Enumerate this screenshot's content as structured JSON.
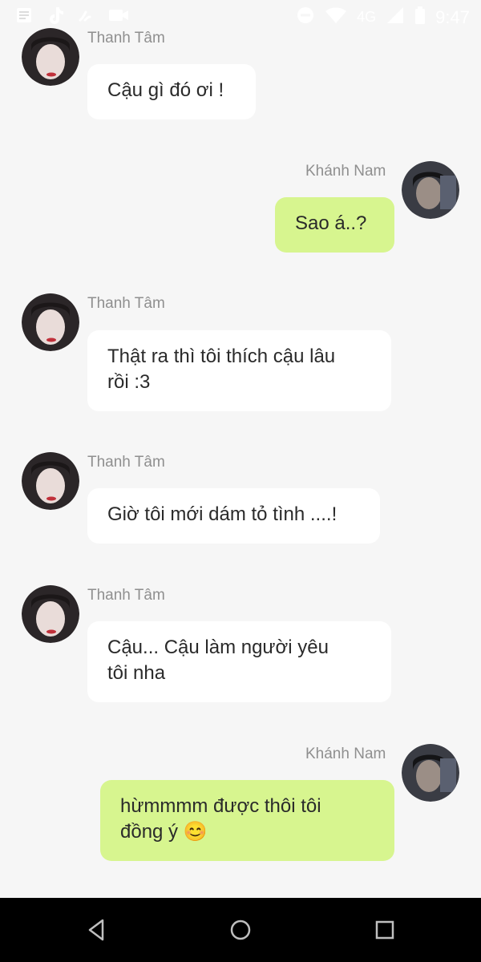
{
  "status_bar": {
    "network": "4G",
    "time": "9:47",
    "left_icons": [
      "news-icon",
      "tiktok-icon",
      "gesture-icon",
      "video-icon"
    ],
    "right_icons": [
      "do-not-disturb-icon",
      "wifi-icon",
      "signal-icon",
      "battery-icon"
    ]
  },
  "messages": [
    {
      "sender": "Thanh Tâm",
      "side": "incoming",
      "text": "Cậu gì đó ơi !"
    },
    {
      "sender": "Khánh Nam",
      "side": "outgoing",
      "text": "Sao á..?"
    },
    {
      "sender": "Thanh Tâm",
      "side": "incoming",
      "text_lines": [
        "Thật ra thì tôi thích cậu lâu",
        "rồi :3"
      ]
    },
    {
      "sender": "Thanh Tâm",
      "side": "incoming",
      "text": "Giờ tôi mới dám tỏ tình ....!"
    },
    {
      "sender": "Thanh Tâm",
      "side": "incoming",
      "text_lines": [
        "Cậu... Cậu làm người yêu",
        "tôi nha"
      ]
    },
    {
      "sender": "Khánh Nam",
      "side": "outgoing",
      "text_lines": [
        "hừmmmm được thôi tôi",
        "đồng ý 😊"
      ]
    }
  ],
  "colors": {
    "background": "#f6f6f6",
    "incoming_bubble": "#ffffff",
    "outgoing_bubble": "#d7f58f",
    "sender_name": "#8f8f8f",
    "nav_bar": "#000000"
  },
  "navigation_bar": {
    "buttons": [
      "back-icon",
      "home-icon",
      "recents-icon"
    ]
  }
}
